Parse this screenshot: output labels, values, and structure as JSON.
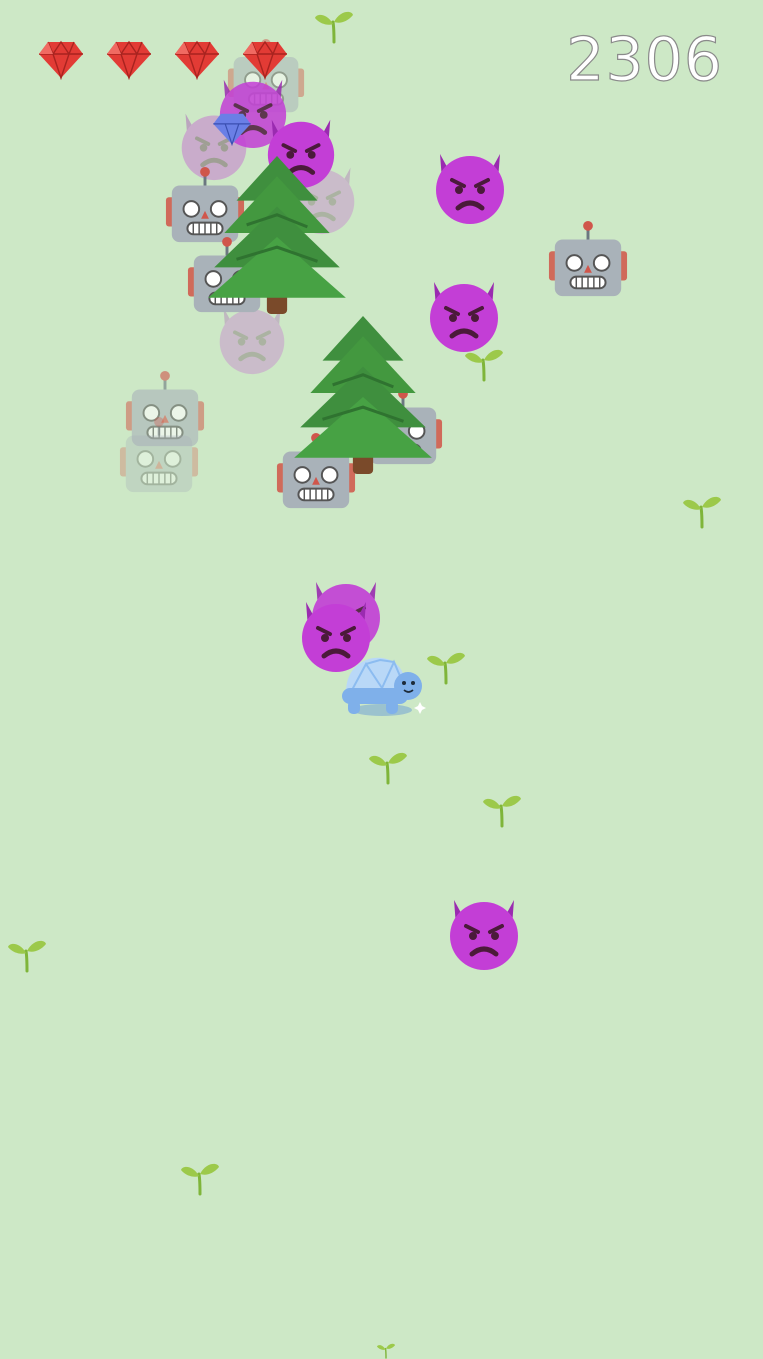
{
  "hud": {
    "score": "2306",
    "lives": 4
  },
  "colors": {
    "background": "#cde8c6",
    "gem": "#e23b35",
    "demon": "#c33ed6",
    "robot": "#a9b2b9",
    "tree": "#3f8f3e",
    "sprout": "#7fb53a",
    "player": "#8cbcf0"
  },
  "icons": {
    "gem": "red-gem-icon",
    "demon": "angry-demon-icon",
    "robot": "robot-face-icon",
    "tree": "evergreen-tree-icon",
    "sprout": "seedling-icon",
    "player": "crystal-turtle-icon"
  }
}
